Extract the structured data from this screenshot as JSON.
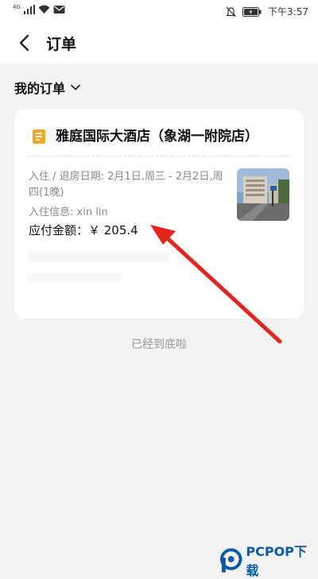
{
  "status_bar": {
    "network": "4G",
    "time": "下午3:57",
    "icons": [
      "signal-icon",
      "wifi-icon",
      "message-icon",
      "mute-icon",
      "battery-icon"
    ]
  },
  "header": {
    "title": "订单",
    "back_icon": "chevron-left-icon"
  },
  "section": {
    "label": "我的订单"
  },
  "order": {
    "hotel_name": "雅庭国际大酒店（象湖一附院店）",
    "dates": "入住 / 退房日期: 2月1日,周三 - 2月2日,周四(1晚)",
    "guest": "入住信息: xin lin",
    "amount": "应付金额：￥ 205.4"
  },
  "footer": {
    "end_text": "已经到底啦"
  },
  "watermark": {
    "text": "PCPOP下载"
  },
  "colors": {
    "background": "#f3f3f3",
    "card": "#ffffff",
    "hotel_icon": "#f5a623",
    "annotation_arrow": "#e8231c",
    "watermark": "#0a5aa8"
  }
}
